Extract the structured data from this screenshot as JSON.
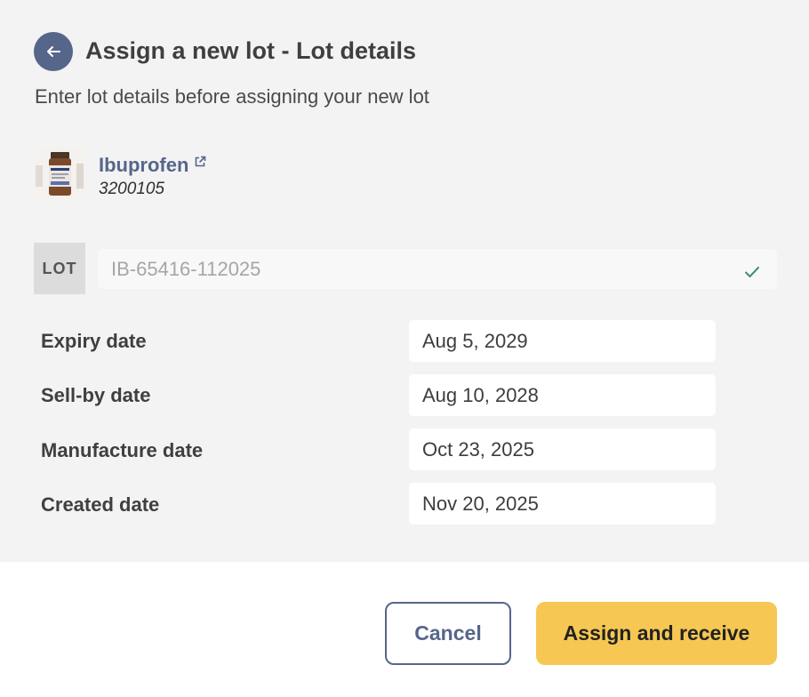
{
  "header": {
    "title": "Assign a new lot - Lot details",
    "subtitle": "Enter lot details before assigning your new lot"
  },
  "icons": {
    "back": "arrow-left-icon",
    "external_link": "external-link-icon",
    "valid": "checkmark-icon"
  },
  "product": {
    "name": "Ibuprofen",
    "code": "3200105"
  },
  "lot": {
    "badge": "LOT",
    "placeholder": "IB-65416-112025"
  },
  "dates": {
    "expiry_label": "Expiry date",
    "expiry_value": "Aug 5, 2029",
    "sellby_label": "Sell-by date",
    "sellby_value": "Aug 10, 2028",
    "manufacture_label": "Manufacture date",
    "manufacture_value": "Oct 23, 2025",
    "created_label": "Created date",
    "created_value": "Nov 20, 2025"
  },
  "footer": {
    "cancel_label": "Cancel",
    "assign_label": "Assign and receive"
  },
  "colors": {
    "panel_bg": "#f3f3f3",
    "primary": "#56668a",
    "accent": "#f6c752",
    "valid_check": "#3f8f7d"
  }
}
